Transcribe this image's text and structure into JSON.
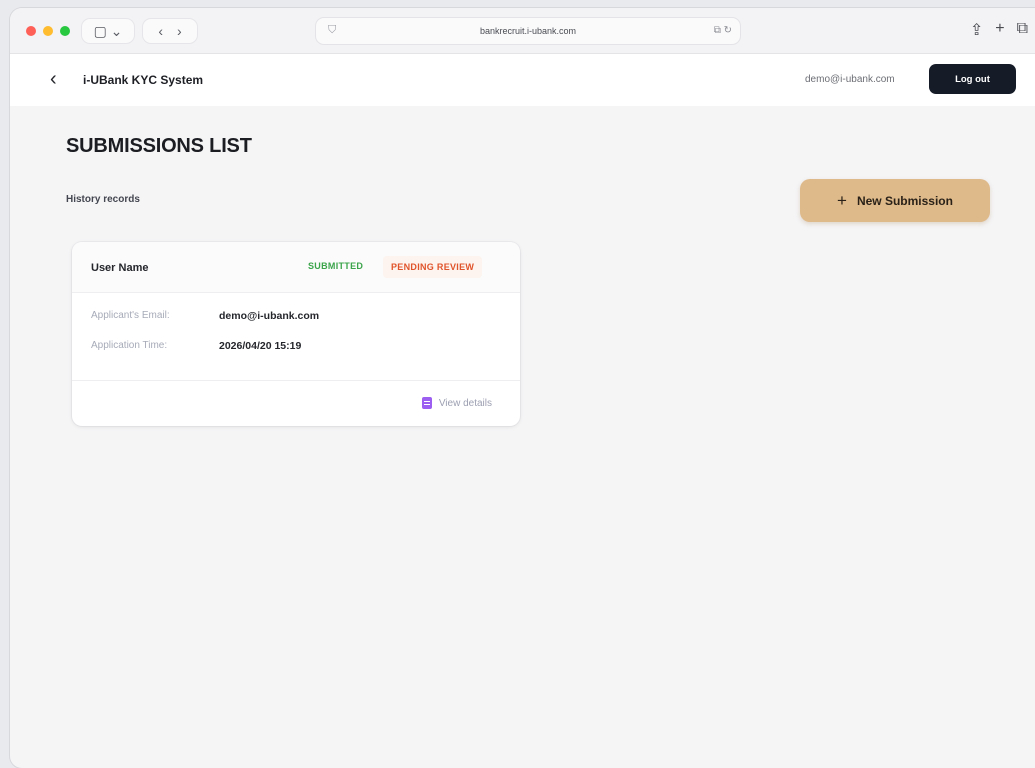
{
  "browser": {
    "url": "bankrecruit.i-ubank.com",
    "sidebar_toggle": "▢ ⌄",
    "back": "‹",
    "forward": "›",
    "url_shield": "⛉",
    "url_right": "⧉ ↻",
    "share": "⇪",
    "new_tab": "+",
    "tabs_overview": "⧉"
  },
  "header": {
    "back": "‹",
    "title": "i-UBank KYC System",
    "user_email": "demo@i-ubank.com",
    "logout_label": "Log out"
  },
  "main": {
    "page_title": "SUBMISSIONS LIST",
    "history_label": "History records",
    "new_submission_icon": "+",
    "new_submission_label": "New Submission"
  },
  "submissions": [
    {
      "user_name": "User Name",
      "status_submitted": "SUBMITTED",
      "status_review": "PENDING REVIEW",
      "email_label": "Applicant's Email:",
      "email_value": "demo@i-ubank.com",
      "time_label": "Application Time:",
      "time_value": "2026/04/20 15:19",
      "view_details_label": "View details"
    }
  ],
  "colors": {
    "accent_button": "#deb98a",
    "logout_button": "#151b27",
    "submitted": "#3aa44a",
    "pending": "#e0542b",
    "doc_icon": "#9b5ef0"
  }
}
